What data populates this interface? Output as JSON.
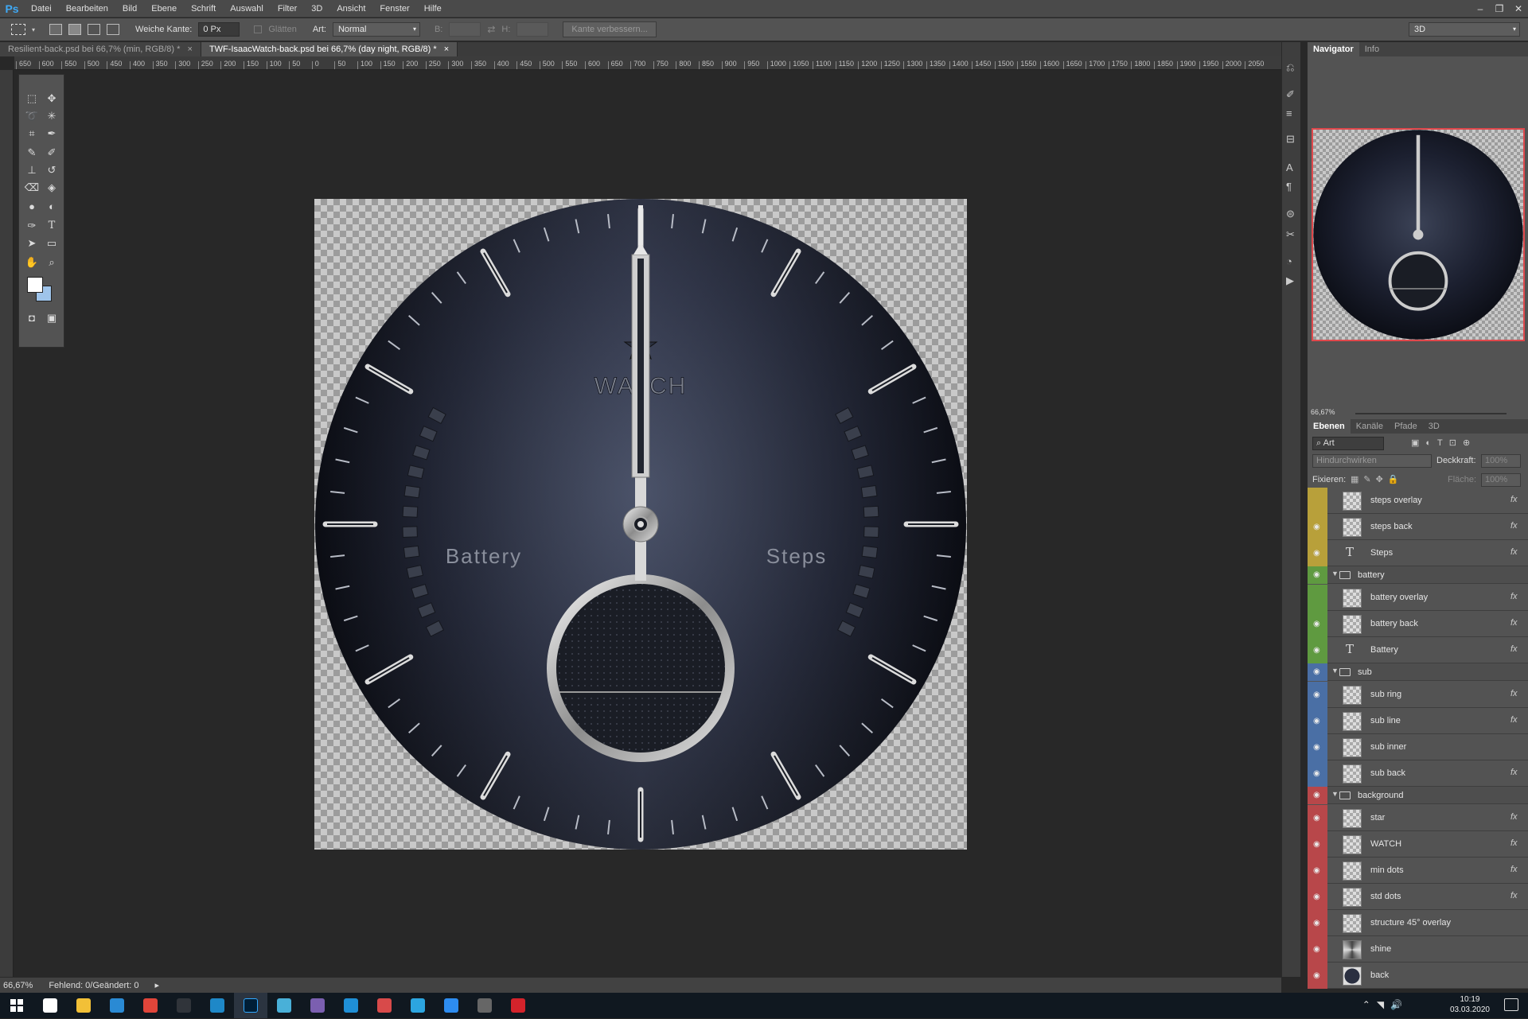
{
  "app": {
    "logo": "Ps"
  },
  "menu": [
    "Datei",
    "Bearbeiten",
    "Bild",
    "Ebene",
    "Schrift",
    "Auswahl",
    "Filter",
    "3D",
    "Ansicht",
    "Fenster",
    "Hilfe"
  ],
  "window_controls": [
    "–",
    "❐",
    "✕"
  ],
  "options": {
    "feather_label": "Weiche Kante:",
    "feather_value": "0 Px",
    "antialias_label": "Glätten",
    "style_label": "Art:",
    "style_value": "Normal",
    "width_label": "B:",
    "height_label": "H:",
    "refine_button": "Kante verbessern...",
    "workspace": "3D"
  },
  "tabs": [
    {
      "label": "Resilient-back.psd bei 66,7% (min, RGB/8) *",
      "close": "×"
    },
    {
      "label": "TWF-IsaacWatch-back.psd bei 66,7% (day night, RGB/8) *",
      "close": "×"
    }
  ],
  "ruler_labels": [
    "650",
    "600",
    "550",
    "500",
    "450",
    "400",
    "350",
    "300",
    "250",
    "200",
    "150",
    "100",
    "50",
    "0",
    "50",
    "100",
    "150",
    "200",
    "250",
    "300",
    "350",
    "400",
    "450",
    "500",
    "550",
    "600",
    "650",
    "700",
    "750",
    "800",
    "850",
    "900",
    "950",
    "1000",
    "1050",
    "1100",
    "1150",
    "1200",
    "1250",
    "1300",
    "1350",
    "1400",
    "1450",
    "1500",
    "1550",
    "1600",
    "1650",
    "1700",
    "1750",
    "1800",
    "1850",
    "1900",
    "1950",
    "2000",
    "2050"
  ],
  "watch": {
    "brand": "WATCH",
    "left_label": "Battery",
    "right_label": "Steps"
  },
  "navigator": {
    "tabs": [
      "Navigator",
      "Info"
    ],
    "zoom": "66,67%"
  },
  "layers_panel": {
    "tabs": [
      "Ebenen",
      "Kanäle",
      "Pfade",
      "3D"
    ],
    "filter": "Art",
    "blend_mode": "Hindurchwirken",
    "opacity_label": "Deckkraft:",
    "opacity_value": "100%",
    "lock_label": "Fixieren:",
    "fill_label": "Fläche:",
    "fill_value": "100%",
    "items": [
      {
        "kind": "layer",
        "name": "steps overlay",
        "color": "#b8a03a",
        "visible": false,
        "fx": true,
        "thumb": "checker"
      },
      {
        "kind": "layer",
        "name": "steps back",
        "color": "#b8a03a",
        "visible": true,
        "fx": true,
        "thumb": "checker"
      },
      {
        "kind": "layer",
        "name": "Steps",
        "color": "#b8a03a",
        "visible": true,
        "fx": true,
        "thumb": "text"
      },
      {
        "kind": "group",
        "name": "battery",
        "color": "#5f9a40",
        "visible": true
      },
      {
        "kind": "layer",
        "name": "battery overlay",
        "color": "#5f9a40",
        "visible": false,
        "fx": true,
        "thumb": "checker"
      },
      {
        "kind": "layer",
        "name": "battery back",
        "color": "#5f9a40",
        "visible": true,
        "fx": true,
        "thumb": "checker"
      },
      {
        "kind": "layer",
        "name": "Battery",
        "color": "#5f9a40",
        "visible": true,
        "fx": true,
        "thumb": "text"
      },
      {
        "kind": "group",
        "name": "sub",
        "color": "#4a6fa5",
        "visible": true
      },
      {
        "kind": "layer",
        "name": "sub ring",
        "color": "#4a6fa5",
        "visible": true,
        "fx": true,
        "thumb": "checker"
      },
      {
        "kind": "layer",
        "name": "sub line",
        "color": "#4a6fa5",
        "visible": true,
        "fx": true,
        "thumb": "checker"
      },
      {
        "kind": "layer",
        "name": "sub inner",
        "color": "#4a6fa5",
        "visible": true,
        "fx": false,
        "thumb": "checker"
      },
      {
        "kind": "layer",
        "name": "sub back",
        "color": "#4a6fa5",
        "visible": true,
        "fx": true,
        "thumb": "checker"
      },
      {
        "kind": "group",
        "name": "background",
        "color": "#b8474a",
        "visible": true
      },
      {
        "kind": "layer",
        "name": "star",
        "color": "#b8474a",
        "visible": true,
        "fx": true,
        "thumb": "checker"
      },
      {
        "kind": "layer",
        "name": "WATCH",
        "color": "#b8474a",
        "visible": true,
        "fx": true,
        "thumb": "checker"
      },
      {
        "kind": "layer",
        "name": "min dots",
        "color": "#b8474a",
        "visible": true,
        "fx": true,
        "thumb": "checker"
      },
      {
        "kind": "layer",
        "name": "std dots",
        "color": "#b8474a",
        "visible": true,
        "fx": true,
        "thumb": "checker"
      },
      {
        "kind": "layer",
        "name": "structure 45° overlay",
        "color": "#b8474a",
        "visible": true,
        "fx": false,
        "thumb": "checker"
      },
      {
        "kind": "layer",
        "name": "shine",
        "color": "#b8474a",
        "visible": true,
        "fx": false,
        "thumb": "shine"
      },
      {
        "kind": "layer",
        "name": "back",
        "color": "#b8474a",
        "visible": true,
        "fx": false,
        "thumb": "dark"
      }
    ]
  },
  "status": {
    "zoom": "66,67%",
    "info": "Fehlend: 0/Geändert: 0"
  },
  "taskbar": {
    "time": "10:19",
    "date": "03.03.2020",
    "apps": [
      {
        "name": "task-view",
        "color": "#ffffff"
      },
      {
        "name": "explorer",
        "color": "#f2c037"
      },
      {
        "name": "mail",
        "color": "#2a8ad4"
      },
      {
        "name": "chrome",
        "color": "#e0453a"
      },
      {
        "name": "app-dark",
        "color": "#30343a"
      },
      {
        "name": "globe",
        "color": "#1e88c8"
      },
      {
        "name": "photoshop",
        "color": "#31a8ff"
      },
      {
        "name": "cloud",
        "color": "#49b0d8"
      },
      {
        "name": "eclipse",
        "color": "#7b5fb0"
      },
      {
        "name": "browser",
        "color": "#1f8fd6"
      },
      {
        "name": "dots",
        "color": "#d84a4a"
      },
      {
        "name": "telegram",
        "color": "#2ca5e0"
      },
      {
        "name": "messenger",
        "color": "#2d8cf0"
      },
      {
        "name": "mic",
        "color": "#666666"
      },
      {
        "name": "huawei",
        "color": "#d4232b"
      }
    ]
  }
}
